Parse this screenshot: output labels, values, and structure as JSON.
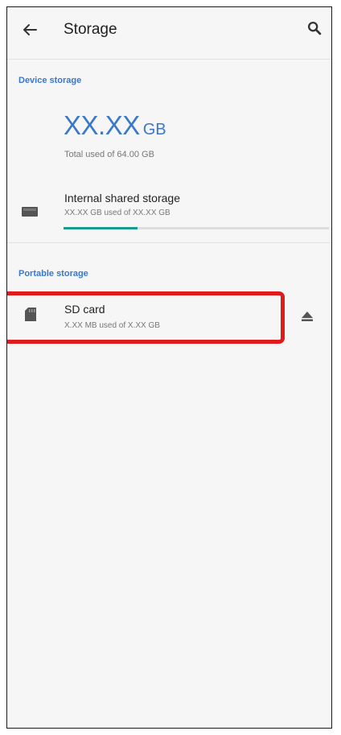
{
  "appbar": {
    "title": "Storage",
    "back_icon": "arrow-left-icon",
    "search_icon": "search-icon"
  },
  "device_storage": {
    "header": "Device storage",
    "total_value": "XX.XX",
    "total_unit": "GB",
    "total_subtitle": "Total used of 64.00 GB",
    "internal": {
      "title": "Internal shared storage",
      "subtitle": "XX.XX GB used of XX.XX GB",
      "usage_fraction": 0.28
    }
  },
  "portable_storage": {
    "header": "Portable storage",
    "sd_card": {
      "title": "SD card",
      "subtitle": "X.XX MB used of X.XX GB",
      "eject_icon": "eject-icon"
    }
  },
  "colors": {
    "accent": "#3a78c9",
    "progress": "#1a9a8a",
    "highlight": "#e01b1b"
  }
}
